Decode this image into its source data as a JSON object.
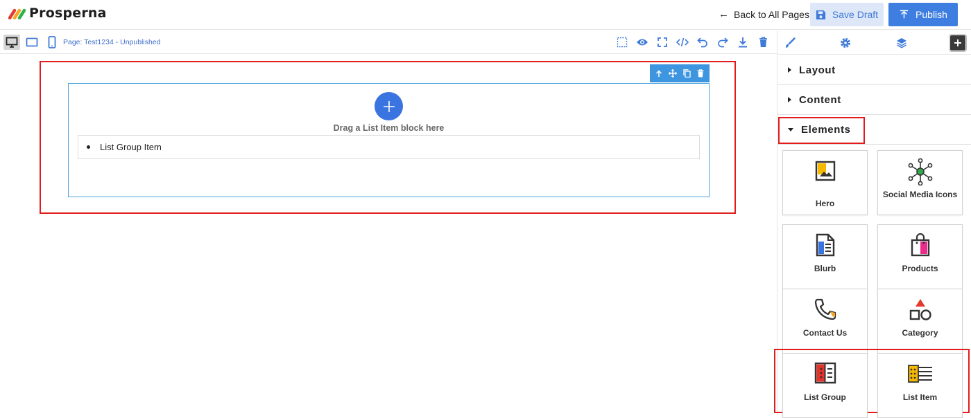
{
  "header": {
    "brand": "Prosperna",
    "back_label": "Back to All Pages",
    "save_draft_label": "Save Draft",
    "publish_label": "Publish"
  },
  "toolbar": {
    "page_label": "Page: Test1234 - Unpublished",
    "device_modes": [
      "desktop",
      "tablet",
      "mobile"
    ],
    "active_device": "desktop",
    "tools": [
      "select-outline-icon",
      "preview-eye-icon",
      "fullscreen-icon",
      "code-icon",
      "undo-icon",
      "redo-icon",
      "download-icon",
      "delete-icon"
    ]
  },
  "canvas": {
    "drag_hint": "Drag a List Item block here",
    "list_item_text": "List Group Item",
    "block_tools": [
      "arrow-up-icon",
      "move-icon",
      "copy-icon",
      "trash-icon"
    ]
  },
  "panel": {
    "tabs": [
      "brush-icon",
      "gear-icon",
      "layers-icon"
    ],
    "sections": [
      {
        "label": "Layout",
        "expanded": false
      },
      {
        "label": "Content",
        "expanded": false
      },
      {
        "label": "Elements",
        "expanded": true
      }
    ],
    "elements": [
      {
        "label": "Hero",
        "icon": "image-icon"
      },
      {
        "label": "Social Media Icons",
        "icon": "network-icon"
      },
      {
        "label": "Blurb",
        "icon": "document-icon"
      },
      {
        "label": "Products",
        "icon": "shopping-bag-icon"
      },
      {
        "label": "Contact Us",
        "icon": "phone-icon"
      },
      {
        "label": "Category",
        "icon": "shapes-icon"
      },
      {
        "label": "List Group",
        "icon": "list-group-icon"
      },
      {
        "label": "List Item",
        "icon": "list-item-icon"
      }
    ]
  },
  "colors": {
    "primary": "#3d7ee0",
    "highlight": "#e21c1c",
    "block_border": "#4aa0e0"
  }
}
